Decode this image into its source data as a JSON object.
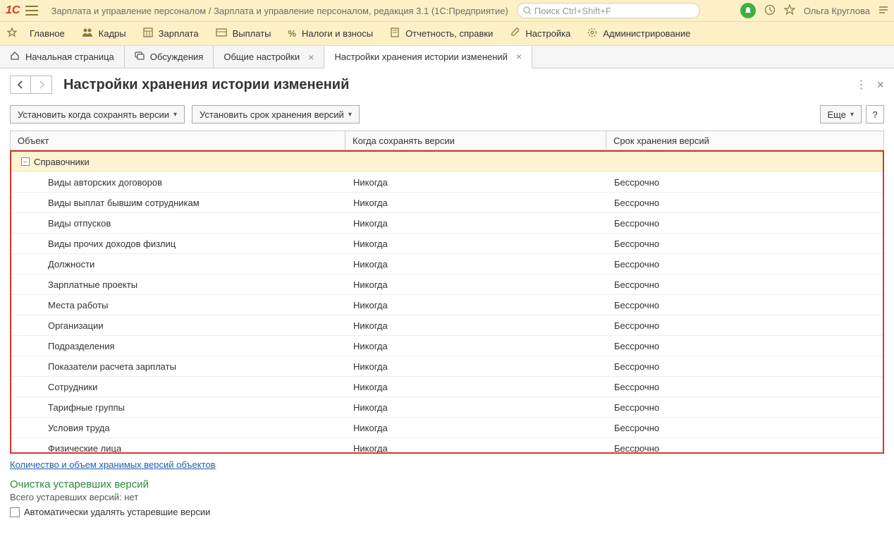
{
  "titlebar": {
    "title": "Зарплата и управление персоналом / Зарплата и управление персоналом, редакция 3.1  (1С:Предприятие)",
    "search_placeholder": "Поиск Ctrl+Shift+F",
    "username": "Ольга Круглова"
  },
  "menu": {
    "items": [
      {
        "label": "Главное"
      },
      {
        "label": "Кадры"
      },
      {
        "label": "Зарплата"
      },
      {
        "label": "Выплаты"
      },
      {
        "label": "Налоги и взносы"
      },
      {
        "label": "Отчетность, справки"
      },
      {
        "label": "Настройка"
      },
      {
        "label": "Администрирование"
      }
    ]
  },
  "tabs": {
    "items": [
      {
        "label": "Начальная страница",
        "closable": false,
        "icon": "home"
      },
      {
        "label": "Обсуждения",
        "closable": false,
        "icon": "chat"
      },
      {
        "label": "Общие настройки",
        "closable": true,
        "icon": null
      },
      {
        "label": "Настройки хранения истории изменений",
        "closable": true,
        "icon": null,
        "active": true
      }
    ]
  },
  "page": {
    "title": "Настройки хранения истории изменений"
  },
  "toolbar": {
    "btn_set_when": "Установить когда сохранять версии",
    "btn_set_term": "Установить срок хранения версий",
    "more": "Еще",
    "help": "?"
  },
  "table": {
    "headers": {
      "object": "Объект",
      "when": "Когда сохранять версии",
      "term": "Срок хранения версий"
    },
    "group": "Справочники",
    "rows": [
      {
        "object": "Виды авторских договоров",
        "when": "Никогда",
        "term": "Бессрочно"
      },
      {
        "object": "Виды выплат бывшим сотрудникам",
        "when": "Никогда",
        "term": "Бессрочно"
      },
      {
        "object": "Виды отпусков",
        "when": "Никогда",
        "term": "Бессрочно"
      },
      {
        "object": "Виды прочих доходов физлиц",
        "when": "Никогда",
        "term": "Бессрочно"
      },
      {
        "object": "Должности",
        "when": "Никогда",
        "term": "Бессрочно"
      },
      {
        "object": "Зарплатные проекты",
        "when": "Никогда",
        "term": "Бессрочно"
      },
      {
        "object": "Места работы",
        "when": "Никогда",
        "term": "Бессрочно"
      },
      {
        "object": "Организации",
        "when": "Никогда",
        "term": "Бессрочно"
      },
      {
        "object": "Подразделения",
        "when": "Никогда",
        "term": "Бессрочно"
      },
      {
        "object": "Показатели расчета зарплаты",
        "when": "Никогда",
        "term": "Бессрочно"
      },
      {
        "object": "Сотрудники",
        "when": "Никогда",
        "term": "Бессрочно"
      },
      {
        "object": "Тарифные группы",
        "when": "Никогда",
        "term": "Бессрочно"
      },
      {
        "object": "Условия труда",
        "when": "Никогда",
        "term": "Бессрочно"
      },
      {
        "object": "Физические лица",
        "when": "Никогда",
        "term": "Бессрочно"
      }
    ]
  },
  "footer": {
    "link": "Количество и объем хранимых версий объектов",
    "cleanup_title": "Очистка устаревших версий",
    "total_text": "Всего устаревших версий: нет",
    "auto_delete": "Автоматически удалять устаревшие версии"
  }
}
